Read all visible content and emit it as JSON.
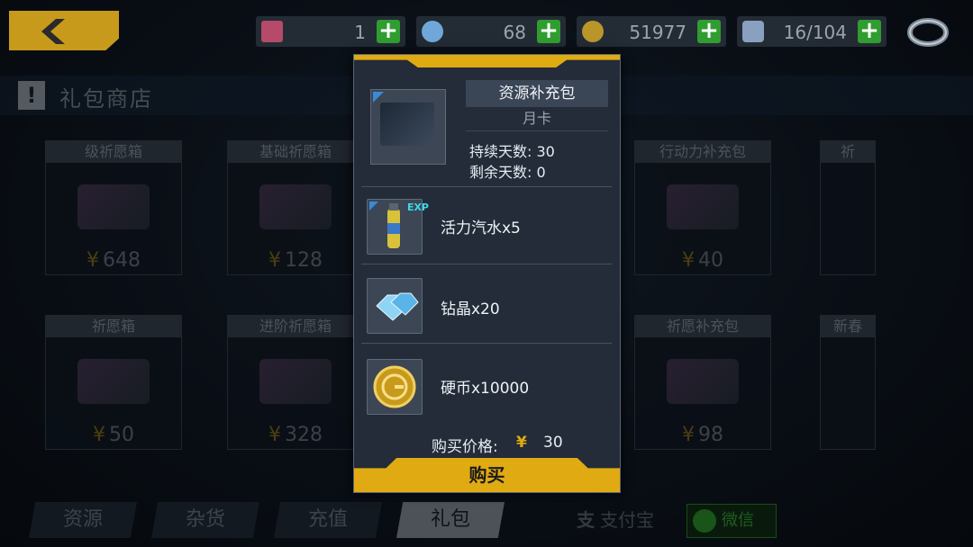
{
  "topbar": {
    "resources": [
      {
        "icon": "energy-chip-icon",
        "value": "1"
      },
      {
        "icon": "diamond-icon",
        "value": "68"
      },
      {
        "icon": "coin-icon",
        "value": "51977"
      },
      {
        "icon": "stamina-icon",
        "value": "16/104"
      }
    ]
  },
  "shop": {
    "title": "礼包商店",
    "cards": [
      {
        "name": "级祈愿箱",
        "price": "648"
      },
      {
        "name": "基础祈愿箱",
        "price": "128"
      },
      {
        "name": "行动力补充包",
        "price": "40"
      },
      {
        "name": "祈",
        "price": ""
      },
      {
        "name": "祈愿箱",
        "price": "50"
      },
      {
        "name": "进阶祈愿箱",
        "price": "328"
      },
      {
        "name": "祈愿补充包",
        "price": "98"
      },
      {
        "name": "新春",
        "price": ""
      }
    ],
    "currency_symbol": "¥"
  },
  "tabs": [
    {
      "label": "资源",
      "active": false
    },
    {
      "label": "杂货",
      "active": false
    },
    {
      "label": "充值",
      "active": false
    },
    {
      "label": "礼包",
      "active": true
    }
  ],
  "payment": {
    "alipay_label": "支付宝",
    "wechat_label": "微信"
  },
  "modal": {
    "pack_name": "资源补充包",
    "pack_type": "月卡",
    "duration_label": "持续天数: 30",
    "remaining_label": "剩余天数: 0",
    "items": [
      {
        "icon": "energy-drink-icon",
        "label": "活力汽水x5",
        "badge": "EXP"
      },
      {
        "icon": "crystal-icon",
        "label": "钻晶x20"
      },
      {
        "icon": "gold-coin-icon",
        "label": "硬币x10000"
      }
    ],
    "price_label": "购买价格:",
    "price_symbol": "¥",
    "price_value": "30",
    "buy_label": "购买"
  }
}
